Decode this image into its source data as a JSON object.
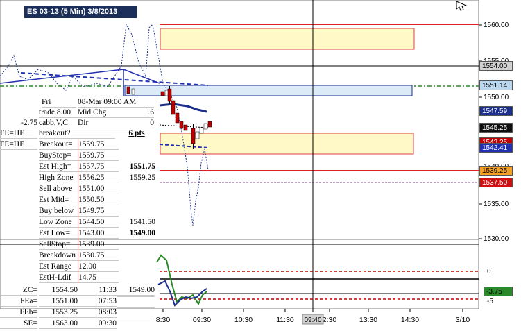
{
  "title": "ES 03-13 (5 Min)  3/8/2013",
  "price_axis": {
    "ticks": [
      "1560.00",
      "1555.00",
      "1550.00",
      "1540.00",
      "1535.00",
      "1530.00"
    ],
    "tags": [
      {
        "text": "1554.00",
        "bg": "#d0d0d0",
        "fg": "#000000"
      },
      {
        "text": "1551.14",
        "bg": "#b9d8f0",
        "fg": "#000000"
      },
      {
        "text": "1547.59",
        "bg": "#1c2f8c",
        "fg": "#ffffff"
      },
      {
        "text": "1545.25",
        "bg": "#101010",
        "fg": "#ffffff"
      },
      {
        "text": "1543.25",
        "bg": "#c00000",
        "fg": "#ffffff"
      },
      {
        "text": "1542.41",
        "bg": "#2030b0",
        "fg": "#ffffff"
      },
      {
        "text": "1539.25",
        "bg": "#f5a020",
        "fg": "#000000"
      },
      {
        "text": "1537.50",
        "bg": "#d01010",
        "fg": "#ffffff"
      }
    ]
  },
  "indicator_axis": {
    "ticks": [
      "0",
      "-5"
    ],
    "tag": {
      "text": "-3.75",
      "bg": "#2a8a2a",
      "fg": "#000000"
    }
  },
  "time_axis": {
    "ticks": [
      "8:30",
      "09:30",
      "10:30",
      "11:30",
      "2:30",
      "13:30",
      "14:30",
      "3/10"
    ],
    "cursor_label": "09:40"
  },
  "panel": {
    "day": "Fri",
    "date_time": "08-Mar  09:00 AM",
    "trade_label": "trade 8.00",
    "mid_chg_label": "Mid Chg",
    "mid_chg_value": "16",
    "offset": "-2.75",
    "cabb": "cabb,V,C",
    "dir_label": "Dir",
    "dir_value": "0",
    "fe_he_1": "FE=HE",
    "fe_he_2": "FE=HE",
    "breakout_q": "breakout?",
    "pts": "6 pts",
    "rows": [
      {
        "label": "Breakout=",
        "value": "1559.75",
        "extra": ""
      },
      {
        "label": "BuyStop=",
        "value": "1559.75",
        "extra": ""
      },
      {
        "label": "Est High=",
        "value": "1557.75",
        "extra": "1551.75"
      },
      {
        "label": "High Zone",
        "value": "1556.25",
        "extra": "1559.25"
      },
      {
        "label": "Sell above",
        "value": "1551.00",
        "extra": ""
      },
      {
        "label": "Est Mid=",
        "value": "1550.50",
        "extra": ""
      },
      {
        "label": "Buy below",
        "value": "1549.75",
        "extra": ""
      },
      {
        "label": "Low Zone",
        "value": "1544.50",
        "extra": "1541.50"
      },
      {
        "label": "Est Low=",
        "value": "1543.00",
        "extra": "1549.00"
      },
      {
        "label": "SellStop=",
        "value": "1539.00",
        "extra": ""
      },
      {
        "label": "Breakdown",
        "value": "1530.75",
        "extra": ""
      },
      {
        "label": "Est Range",
        "value": "12.00",
        "extra": ""
      },
      {
        "label": "EstH-Ldif",
        "value": "14.75",
        "extra": ""
      }
    ],
    "bottom_rows": [
      {
        "label": "ZC=",
        "value": "1554.50",
        "time": "11:33",
        "extra": "1549.00"
      },
      {
        "label": "FEa=",
        "value": "1551.00",
        "time": "07:53",
        "extra": ""
      },
      {
        "label": "FEb=",
        "value": "1553.25",
        "time": "08:03",
        "extra": ""
      },
      {
        "label": "SE=",
        "value": "1563.00",
        "time": "09:30",
        "extra": ""
      }
    ]
  }
}
